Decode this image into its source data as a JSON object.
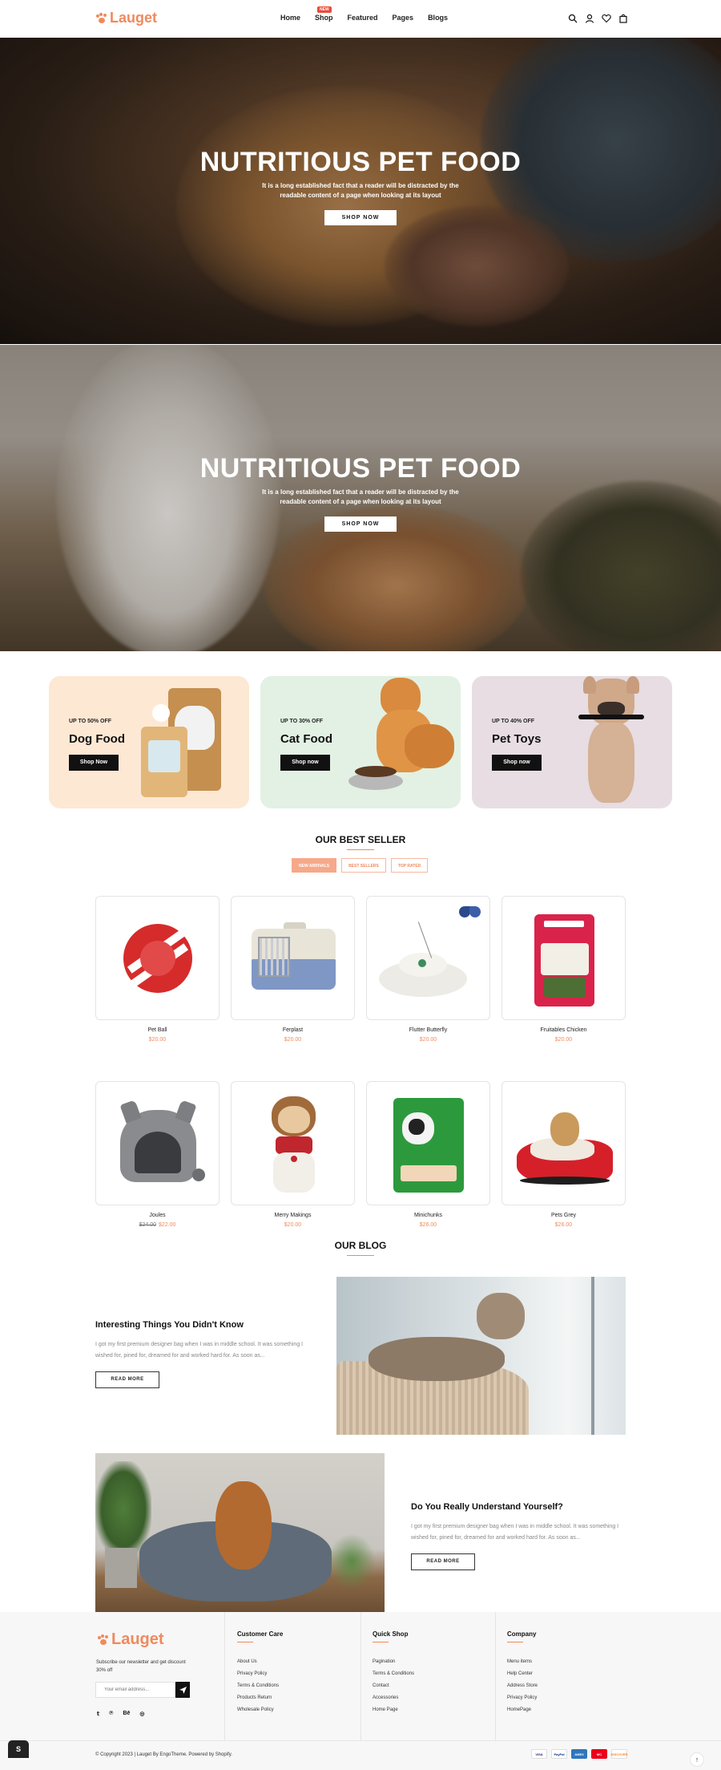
{
  "brand": {
    "name": "Lauget",
    "color": "#f08a5d"
  },
  "nav": {
    "items": [
      "Home",
      "Shop",
      "Featured",
      "Pages",
      "Blogs"
    ],
    "shop_badge": "NEW"
  },
  "header_icons": [
    "search-icon",
    "user-icon",
    "heart-icon",
    "cart-icon"
  ],
  "hero": [
    {
      "title": "NUTRITIOUS PET FOOD",
      "subtitle": "It is a long established fact that a reader will be distracted by the readable content of a page when looking at its layout",
      "button": "SHOP NOW"
    },
    {
      "title": "NUTRITIOUS PET FOOD",
      "subtitle": "It is a long established fact that a reader will be distracted by the readable content of a page when looking at its layout",
      "button": "SHOP NOW"
    }
  ],
  "promos": [
    {
      "small": "UP TO 50% OFF",
      "title": "Dog Food",
      "button": "Shop Now",
      "bg": "#fde8d4"
    },
    {
      "small": "UP TO 30% OFF",
      "title": "Cat Food",
      "button": "Shop now",
      "bg": "#e2f1e4"
    },
    {
      "small": "UP TO 40% OFF",
      "title": "Pet Toys",
      "button": "Shop now",
      "bg": "#e7dde2"
    }
  ],
  "best_seller": {
    "title": "OUR BEST SELLER",
    "tabs": [
      "NEW ARRIVALS",
      "BEST SELLERS",
      "TOP RATED"
    ],
    "products": [
      {
        "name": "Pet Ball",
        "price": "$20.00",
        "old_price": ""
      },
      {
        "name": "Ferplast",
        "price": "$20.00",
        "old_price": ""
      },
      {
        "name": "Flutter Butterfly",
        "price": "$20.00",
        "old_price": ""
      },
      {
        "name": "Fruitables Chicken",
        "price": "$20.00",
        "old_price": ""
      },
      {
        "name": "Joules",
        "price": "$22.00",
        "old_price": "$24.00"
      },
      {
        "name": "Merry Makings",
        "price": "$20.00",
        "old_price": ""
      },
      {
        "name": "Minichunks",
        "price": "$26.00",
        "old_price": ""
      },
      {
        "name": "Pets Grey",
        "price": "$26.00",
        "old_price": ""
      }
    ]
  },
  "blog": {
    "title": "OUR BLOG",
    "posts": [
      {
        "title": "Interesting Things You Didn't Know",
        "excerpt": "I got my first premium designer bag when I was in middle school. It was something I wished for, pined for, dreamed for and worked hard for. As soon as...",
        "button": "READ MORE"
      },
      {
        "title": "Do You Really Understand Yourself?",
        "excerpt": "I got my first premium designer bag when I was in middle school. It was something I wished for, pined for, dreamed for and worked hard for. As soon as...",
        "button": "READ MORE"
      }
    ]
  },
  "footer": {
    "newsletter_text": "Subscribe our newsletter and get discount 30% off",
    "email_placeholder": "Your email address...",
    "social": [
      "twitter-icon",
      "pinterest-icon",
      "behance-icon",
      "instagram-icon"
    ],
    "social_glyphs": [
      "𝕥",
      "℗",
      "Bē",
      "◎"
    ],
    "columns": [
      {
        "title": "Customer Care",
        "links": [
          "About Us",
          "Privacy Policy",
          "Terms & Conditions",
          "Products Return",
          "Wholesale Policy"
        ]
      },
      {
        "title": "Quick Shop",
        "links": [
          "Pagination",
          "Terms & Conditions",
          "Contact",
          "Accessories",
          "Home Page"
        ]
      },
      {
        "title": "Company",
        "links": [
          "Menu items",
          "Help Center",
          "Address Store",
          "Privacy Policy",
          "HomePage"
        ]
      }
    ],
    "copyright": "© Copyright 2023 | Lauget By EngoTheme. Powered by Shopify.",
    "payments": [
      "VISA",
      "PayPal",
      "AMEX",
      "MC",
      "DISCOVER"
    ],
    "payment_colors": [
      "#1a1f71",
      "#003087",
      "#2e77bc",
      "#eb001b",
      "#f58220"
    ]
  }
}
